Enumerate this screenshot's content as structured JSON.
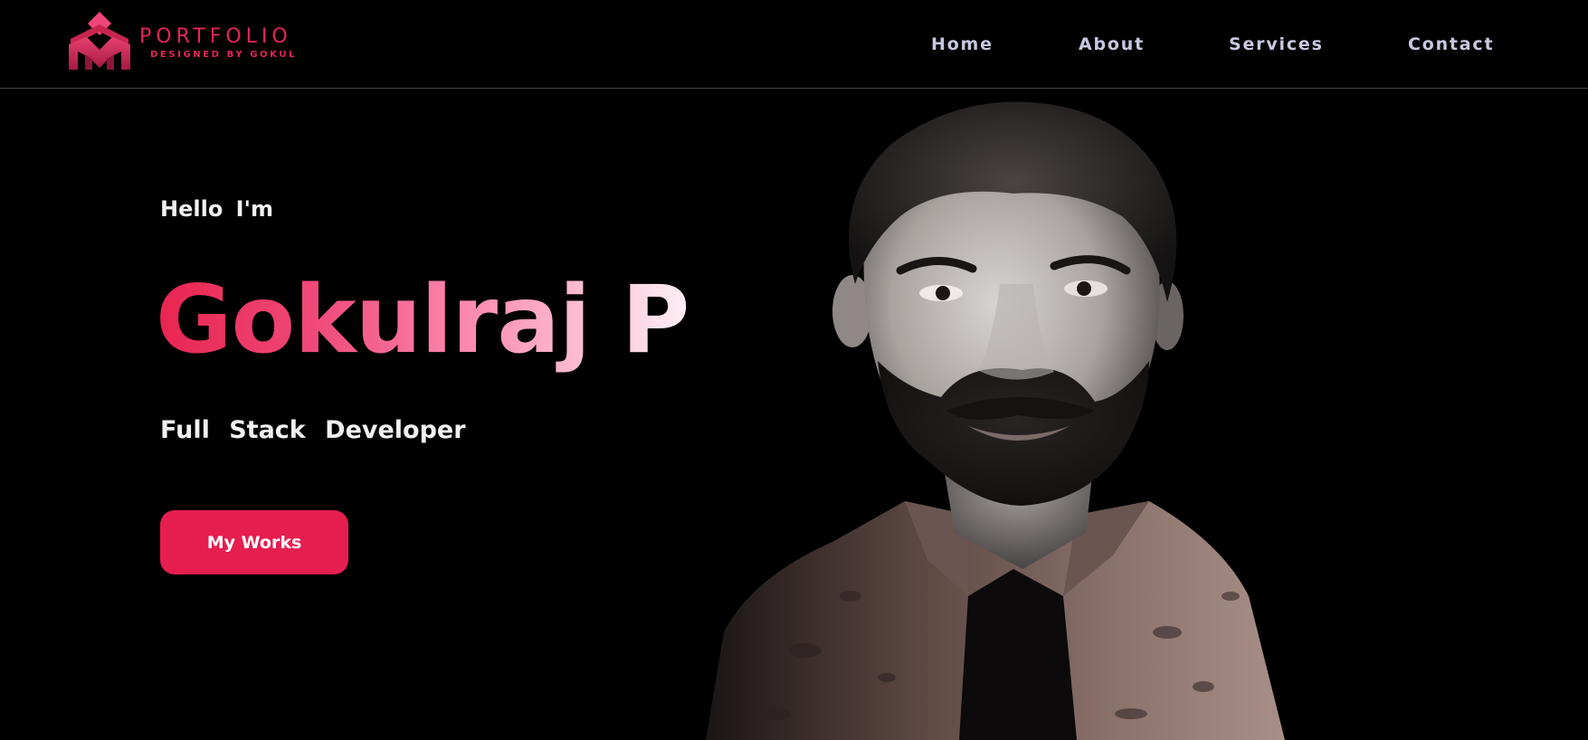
{
  "brand": {
    "title": "PORTFOLIO",
    "subtitle": "DESIGNED BY GOKUL",
    "accent_color": "#e42557",
    "logo_icon": "stacked-m-diamond-logo"
  },
  "nav": {
    "items": [
      {
        "label": "Home"
      },
      {
        "label": "About"
      },
      {
        "label": "Services"
      },
      {
        "label": "Contact"
      }
    ],
    "text_color": "#c8c8e2"
  },
  "hero": {
    "greeting": "Hello  I'm",
    "name": "Gokulraj P",
    "role": "Full  Stack  Developer",
    "cta_label": "My Works",
    "cta_color": "#e61e4f",
    "name_gradient": [
      "#e8244f",
      "#fb8cb2",
      "#fdeff5"
    ],
    "photo": "portrait-photo"
  },
  "page": {
    "background": "#000000"
  }
}
